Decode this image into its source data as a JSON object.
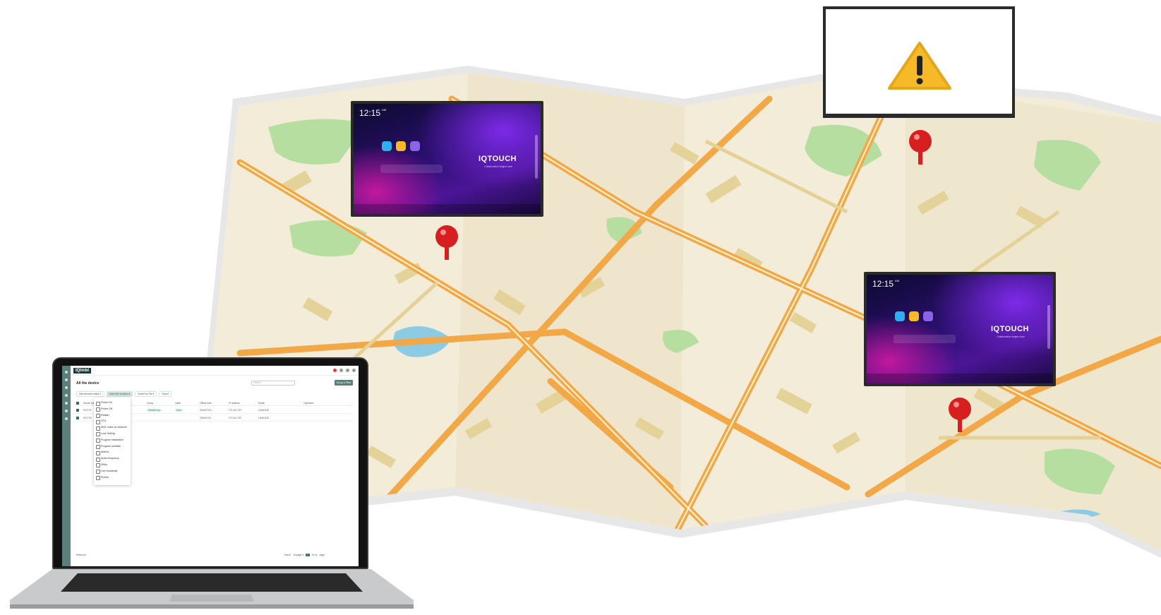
{
  "panels": [
    {
      "clock": "12:15",
      "am": "AM",
      "brand": "IQTOUCH",
      "tagline": "Collaboration begins here"
    },
    {
      "clock": "12:15",
      "am": "AM",
      "brand": "IQTOUCH",
      "tagline": "Collaboration begins here"
    }
  ],
  "alert_panel": {
    "icon": "warning-icon",
    "color": "#f6b928"
  },
  "pin_color": "#d81f1f",
  "laptop": {
    "logo": "IQtmbl",
    "page_title": "All the device",
    "search_placeholder": "Search",
    "new_button": "Group & Filter",
    "filters": [
      "Has selected article 2",
      "Select the function ▾",
      "Sorted by Tier ▾",
      "Export"
    ],
    "columns": [
      "Device Na",
      "Group",
      "Label",
      "Offline time",
      "IP address",
      "Model",
      "Operation"
    ],
    "rows": [
      {
        "name": "SH-TV1",
        "group": "Default Grp",
        "label": "New",
        "offline": "2024/07/10",
        "ip": "172.16.1.20",
        "model": "LDA4111E"
      },
      {
        "name": "SH-TV2",
        "group": "",
        "label": "",
        "offline": "2024/07/11",
        "ip": "172.16.1.30",
        "model": "LDA4111E"
      }
    ],
    "menu": [
      "Power On",
      "Power Off",
      "Restart",
      "OTA",
      "WOL wake on Network",
      "Lock Setting",
      "Program installation",
      "Program uninstall",
      "Alarms",
      "Audio frequency",
      "Video",
      "Live broadcast",
      "Picture"
    ],
    "footer": {
      "select_all": "Select All",
      "total": "Total 2",
      "per_page": "10/page ▾",
      "page": "1",
      "goto": "Go to",
      "page_word": "page"
    }
  }
}
